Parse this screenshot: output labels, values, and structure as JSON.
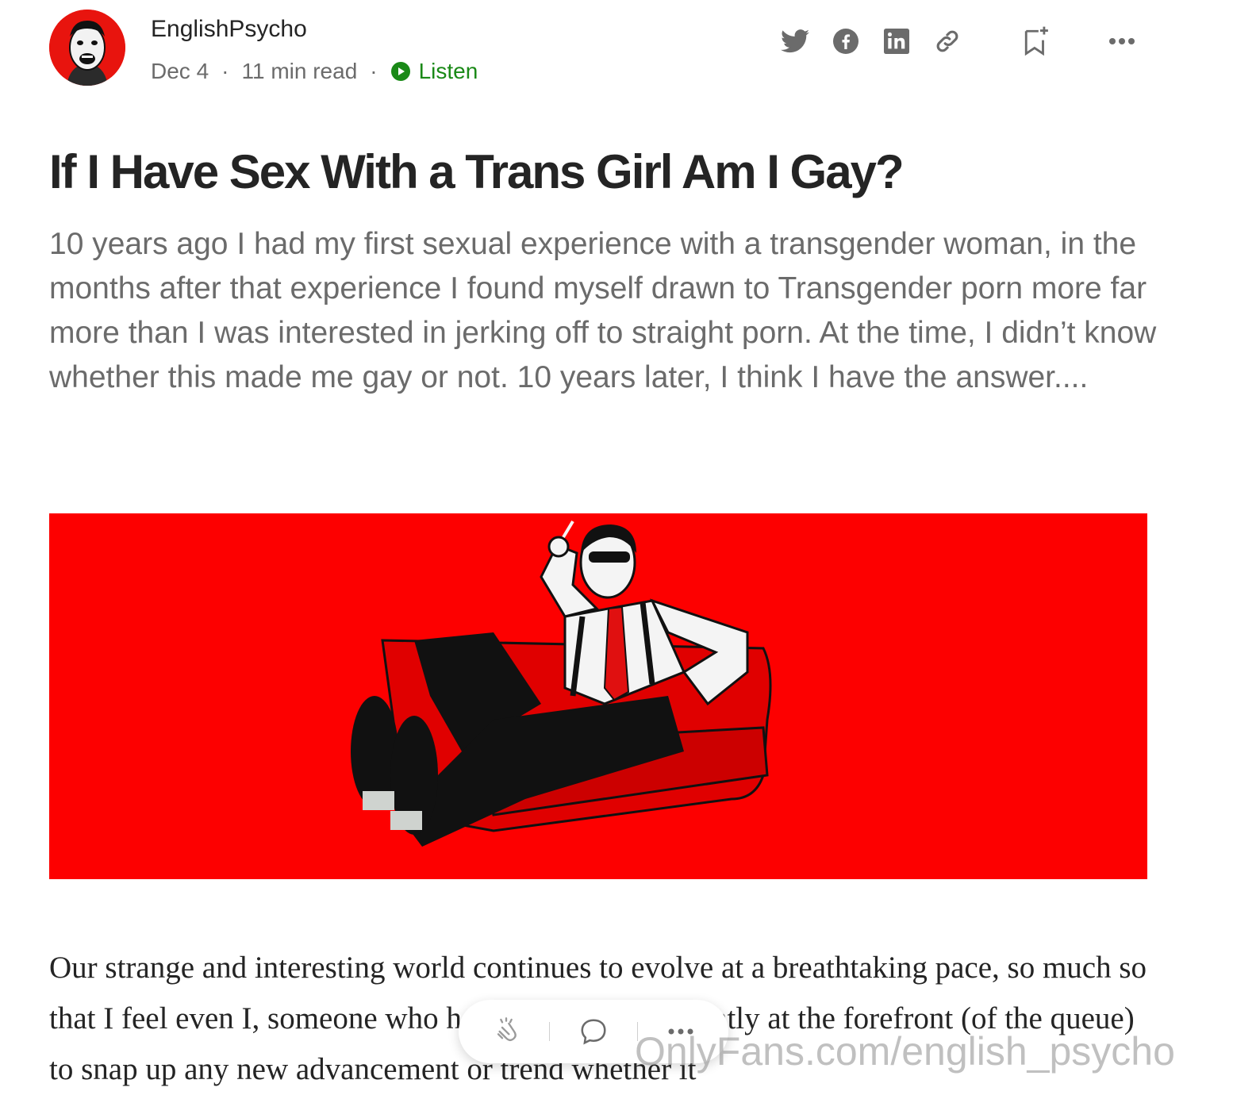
{
  "author": {
    "name": "EnglishPsycho",
    "avatar_icon": "author-avatar-face"
  },
  "meta": {
    "date": "Dec 4",
    "read_time": "11 min read",
    "separator": "·",
    "listen_label": "Listen"
  },
  "actions": {
    "icons": [
      "twitter-icon",
      "facebook-icon",
      "linkedin-icon",
      "link-icon",
      "bookmark-icon",
      "more-icon"
    ]
  },
  "article": {
    "title": "If I Have Sex With a Trans Girl Am I Gay?",
    "subtitle": "10 years ago I had my first sexual experience with a transgender woman, in the months after that experience I found myself drawn to Transgender porn more far more than I was interested in jerking off to straight porn. At the time, I didn’t know whether this made me gay or not. 10 years later, I think I have the answer....",
    "body_paragraph": "Our strange and interesting world continues to evolve at a breathtaking pace, so much so that I feel even I, someone who has been since constantly at the forefront (of the queue) to snap up any new advancement or trend whether it"
  },
  "hero_image": {
    "description_icon": "man-on-red-sofa-illustration"
  },
  "floating_bar": {
    "icons": [
      "clap-icon",
      "comment-icon",
      "more-icon"
    ]
  },
  "watermark": "OnlyFans.com/english_psycho",
  "colors": {
    "accent_green": "#1a8917",
    "hero_red": "#fd0000",
    "text_dark": "#242424",
    "text_grey": "#6b6b6b"
  }
}
